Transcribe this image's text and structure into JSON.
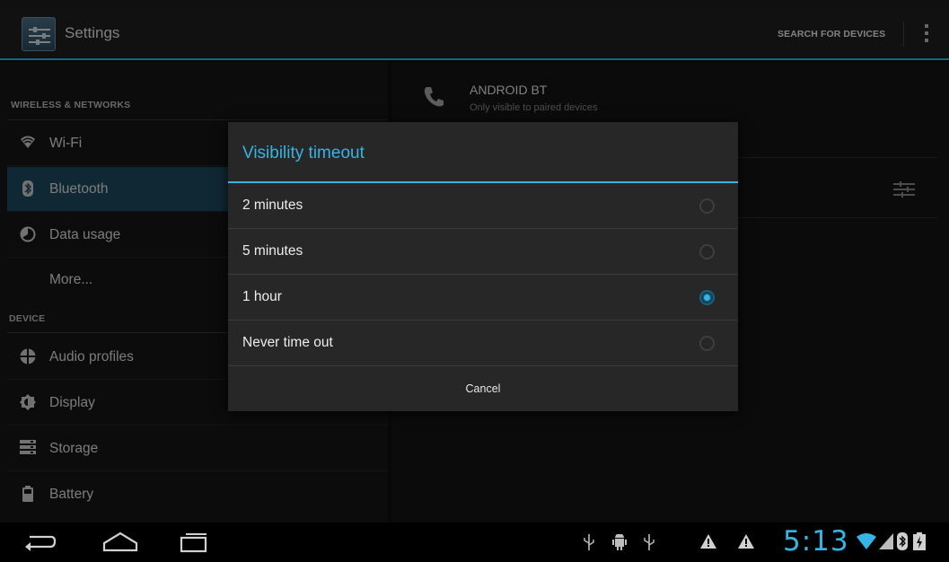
{
  "action_bar": {
    "title": "Settings",
    "search_label": "SEARCH FOR DEVICES",
    "app_icon": "settings-sliders-icon",
    "overflow_icon": "overflow-menu-icon"
  },
  "sidebar": {
    "headers": [
      "WIRELESS & NETWORKS",
      "DEVICE"
    ],
    "items": [
      {
        "label": "Wi-Fi",
        "icon": "wifi-icon"
      },
      {
        "label": "Bluetooth",
        "icon": "bluetooth-icon",
        "selected": true
      },
      {
        "label": "Data usage",
        "icon": "data-usage-icon"
      },
      {
        "label": "More...",
        "icon": ""
      },
      {
        "label": "Audio profiles",
        "icon": "audio-profiles-icon"
      },
      {
        "label": "Display",
        "icon": "display-icon"
      },
      {
        "label": "Storage",
        "icon": "storage-icon"
      },
      {
        "label": "Battery",
        "icon": "battery-icon"
      }
    ]
  },
  "detail": {
    "device_name": "ANDROID BT",
    "device_status": "Only visible to paired devices"
  },
  "dialog": {
    "title": "Visibility timeout",
    "options": [
      {
        "label": "2 minutes",
        "checked": false
      },
      {
        "label": "5 minutes",
        "checked": false
      },
      {
        "label": "1 hour",
        "checked": true
      },
      {
        "label": "Never time out",
        "checked": false
      }
    ],
    "cancel_label": "Cancel"
  },
  "system_bar": {
    "clock": "5:13",
    "accent": "#33b5e5",
    "nav": [
      "back-icon",
      "home-icon",
      "recent-apps-icon"
    ],
    "notifications": [
      "usb-icon",
      "android-debug-icon",
      "usb-icon",
      "warning-icon",
      "warning-icon"
    ],
    "status": [
      "wifi-signal-icon",
      "cell-signal-icon",
      "bluetooth-status-icon",
      "battery-status-icon"
    ]
  }
}
